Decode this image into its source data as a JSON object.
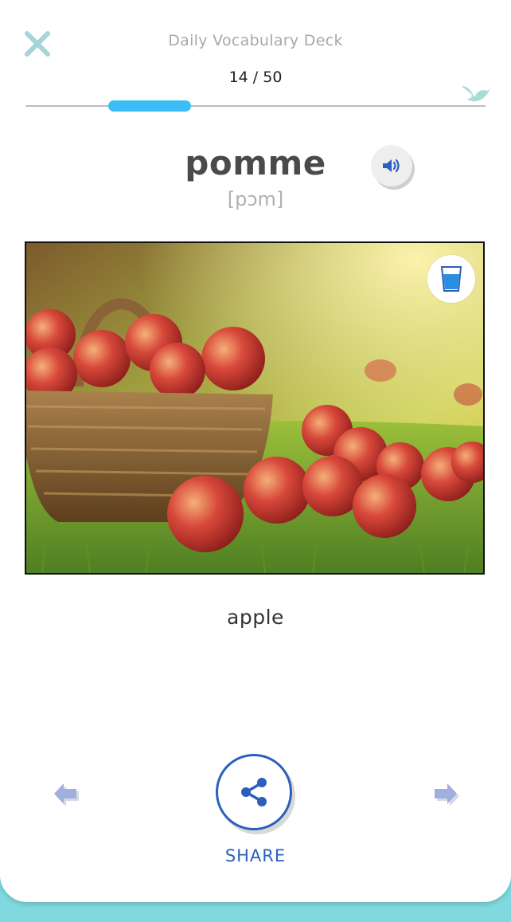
{
  "header": {
    "deck_title": "Daily Vocabulary Deck",
    "counter": "14 / 50",
    "progress": {
      "current": 14,
      "total": 50
    }
  },
  "card": {
    "word": "pomme",
    "phonetic": "[pɔm]",
    "translation": "apple",
    "image_subject": "basket of red apples on grass"
  },
  "actions": {
    "share_label": "SHARE"
  },
  "icons": {
    "close": "close-icon",
    "bird": "bird-icon",
    "audio": "speaker-icon",
    "cup": "water-glass-icon",
    "prev": "arrow-left-icon",
    "next": "arrow-right-icon",
    "share": "share-icon"
  },
  "colors": {
    "accent_blue": "#2a5fbd",
    "progress": "#3dbdf7",
    "teal": "#7fd9df",
    "arrow": "#9fb0dc"
  }
}
